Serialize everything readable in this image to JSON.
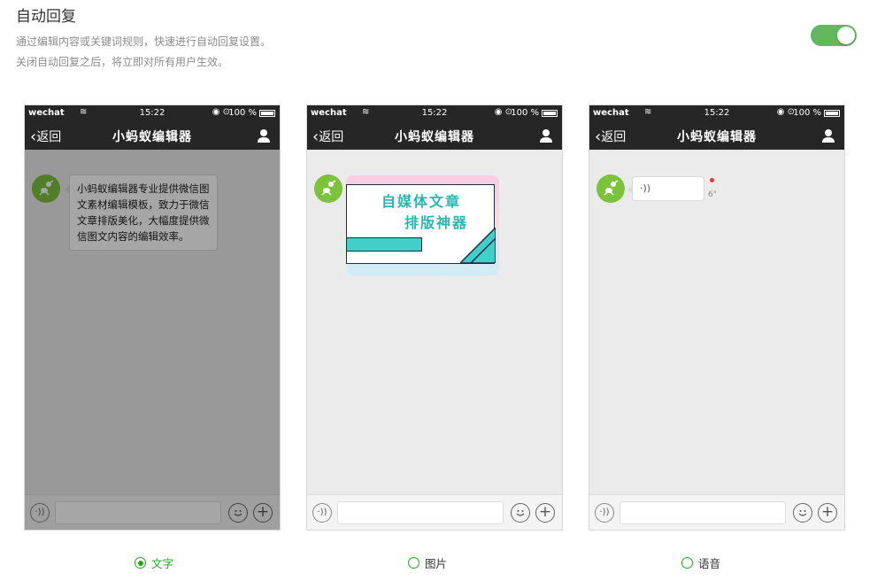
{
  "header": {
    "title": "自动回复",
    "desc_line1": "通过编辑内容或关键词规则，快速进行自动回复设置。",
    "desc_line2": "关闭自动回复之后，将立即对所有用户生效。"
  },
  "toggle": {
    "state": "on"
  },
  "phone": {
    "signal": "wechat",
    "time": "15:22",
    "battery": "100 %",
    "back_label": "返回",
    "title": "小蚂蚁编辑器"
  },
  "previews": {
    "text_message": "小蚂蚁编辑器专业提供微信图文素材编辑模板，致力于微信文章排版美化，大幅度提供微信图文内容的编辑效率。",
    "image_line1": "自媒体文章",
    "image_line2": "排版神器",
    "voice_duration": "6\""
  },
  "options": [
    {
      "label": "文字",
      "checked": true
    },
    {
      "label": "图片",
      "checked": false
    },
    {
      "label": "语音",
      "checked": false
    }
  ],
  "colors": {
    "accent": "#1aad19",
    "toggle_on": "#62b75f",
    "nav_bg": "#262626",
    "avatar": "#7cc33c"
  }
}
